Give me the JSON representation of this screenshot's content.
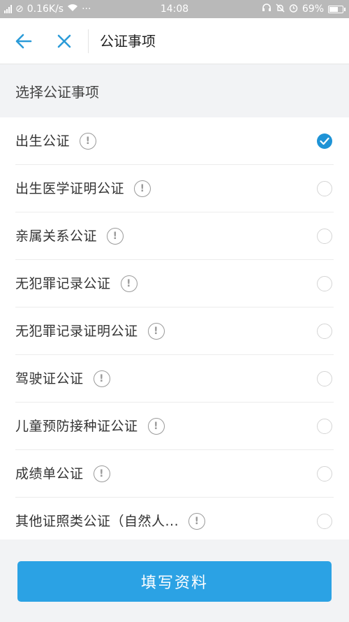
{
  "status_bar": {
    "network_speed": "0.16K/s",
    "more": "···",
    "time": "14:08",
    "battery": "69%",
    "battery_level": 0.69
  },
  "header": {
    "title": "公证事项"
  },
  "section": {
    "title": "选择公证事项"
  },
  "items": [
    {
      "label": "出生公证",
      "selected": true
    },
    {
      "label": "出生医学证明公证",
      "selected": false
    },
    {
      "label": "亲属关系公证",
      "selected": false
    },
    {
      "label": "无犯罪记录公证",
      "selected": false
    },
    {
      "label": "无犯罪记录证明公证",
      "selected": false
    },
    {
      "label": "驾驶证公证",
      "selected": false
    },
    {
      "label": "儿童预防接种证公证",
      "selected": false
    },
    {
      "label": "成绩单公证",
      "selected": false
    },
    {
      "label": "其他证照类公证（自然人...",
      "selected": false
    }
  ],
  "footer": {
    "submit_label": "填写资料"
  },
  "colors": {
    "accent": "#2ba2e4",
    "check": "#1e93d6",
    "status_bar": "#b9b9b9",
    "section_bg": "#f2f3f5"
  }
}
